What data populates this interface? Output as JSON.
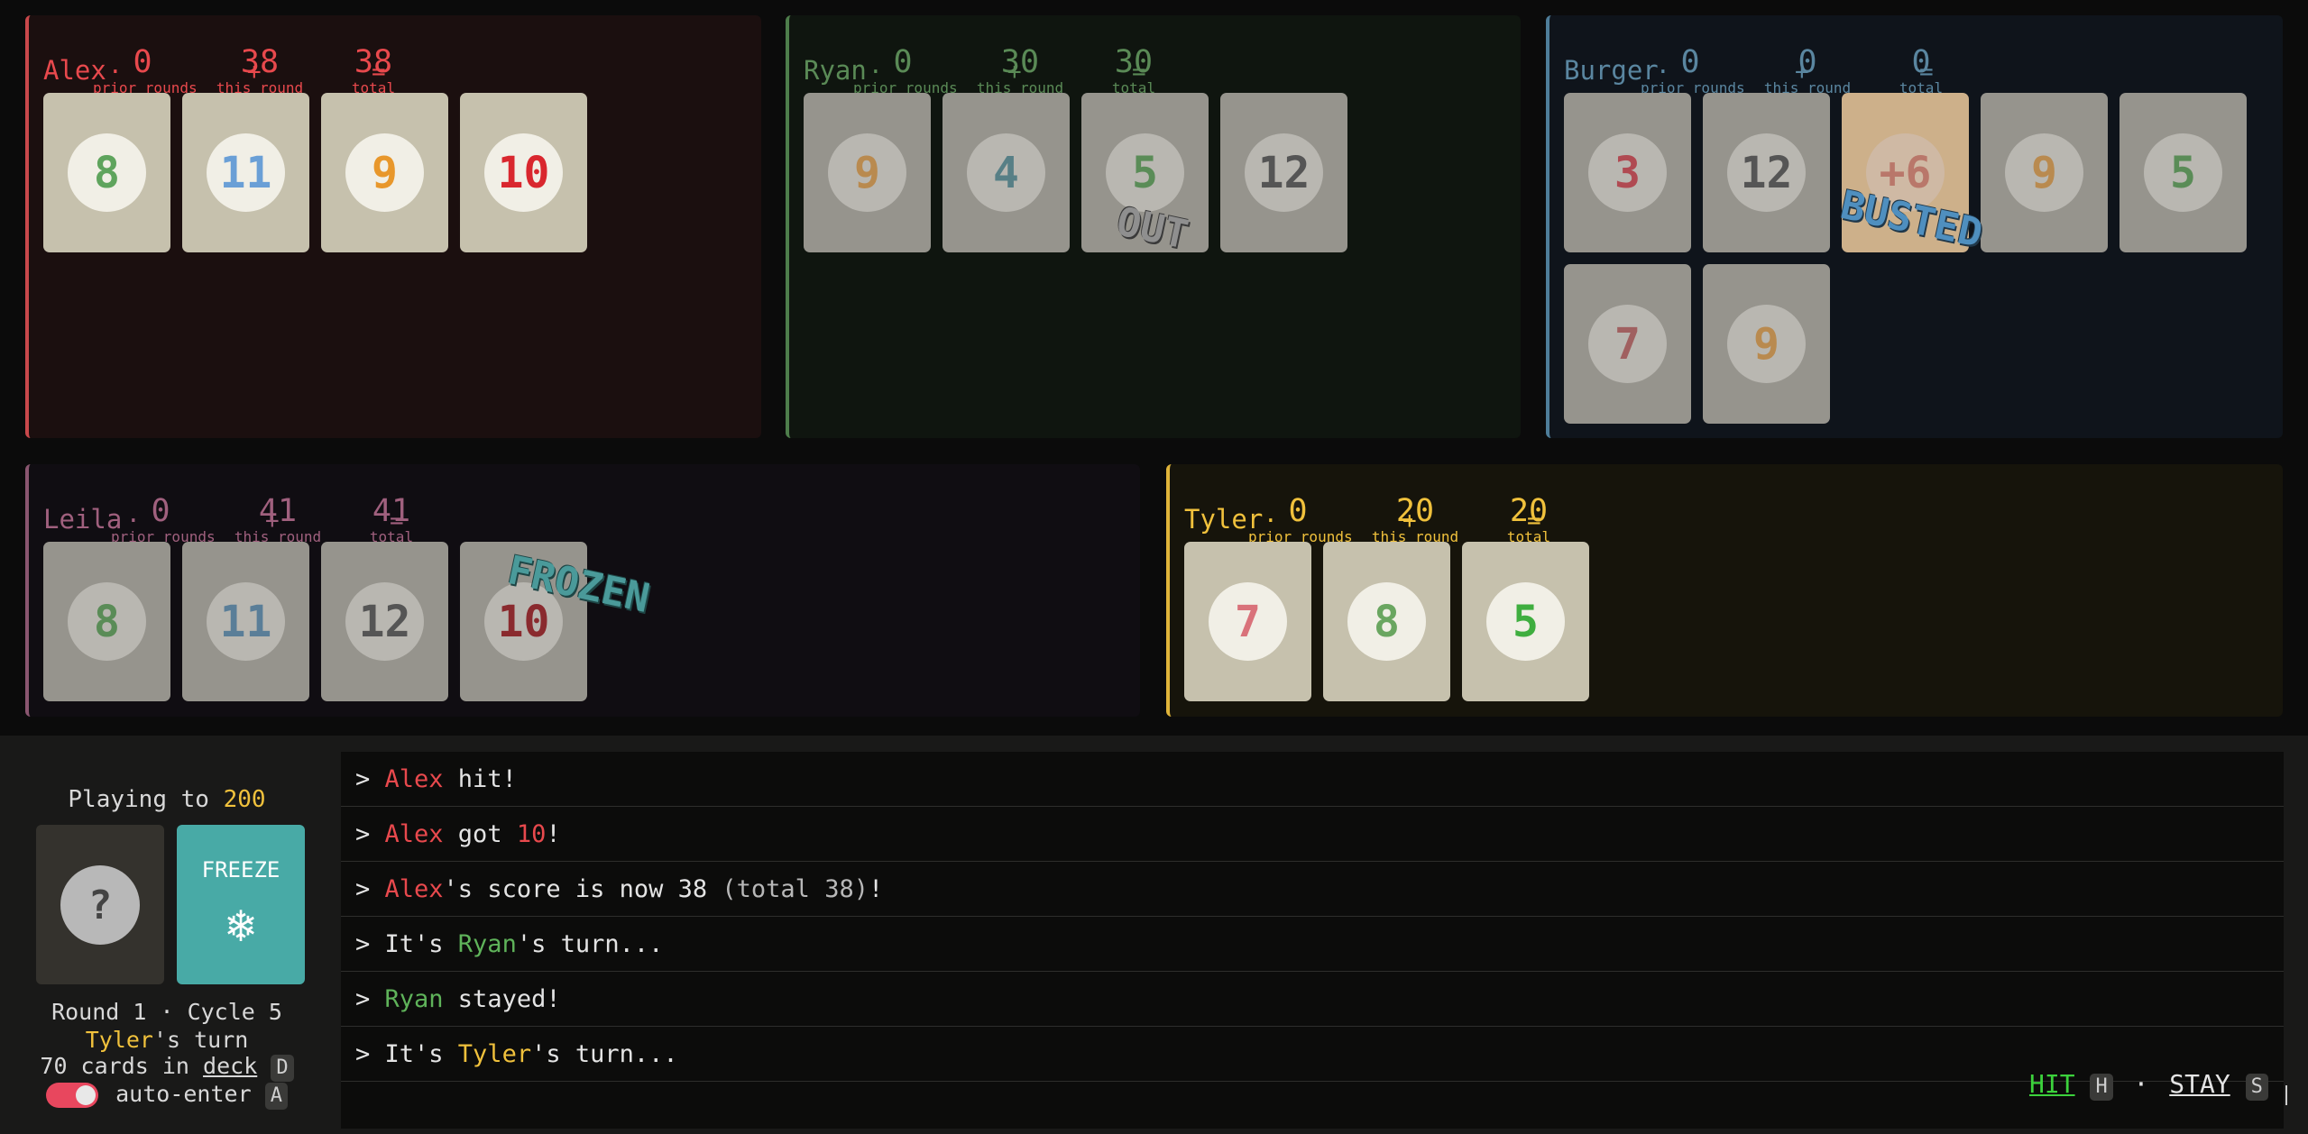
{
  "players": [
    {
      "id": "alex",
      "name": "Alex",
      "color": "#e8494d",
      "bg": "#1b0f0f",
      "border": "#c9484b",
      "prior": "0",
      "this_round": "38",
      "total": "38",
      "labels": {
        "prior": "prior rounds",
        "this": "this round",
        "total": "total"
      },
      "status": "",
      "cards": [
        {
          "value": "8",
          "color": "#5fa45d"
        },
        {
          "value": "11",
          "color": "#6a9fd6"
        },
        {
          "value": "9",
          "color": "#e8972b"
        },
        {
          "value": "10",
          "color": "#d9272e"
        }
      ]
    },
    {
      "id": "ryan",
      "name": "Ryan",
      "color": "#5a8a56",
      "bg": "#0f150f",
      "border": "#4e7d4b",
      "prior": "0",
      "this_round": "30",
      "total": "30",
      "labels": {
        "prior": "prior rounds",
        "this": "this round",
        "total": "total"
      },
      "status": "OUT",
      "cards": [
        {
          "value": "9",
          "color": "#b98a4f"
        },
        {
          "value": "4",
          "color": "#577f86"
        },
        {
          "value": "5",
          "color": "#5a8c57"
        },
        {
          "value": "12",
          "color": "#555555"
        }
      ]
    },
    {
      "id": "burger",
      "name": "Burger",
      "color": "#5a86a0",
      "bg": "#0f141b",
      "border": "#4e7d99",
      "prior": "0",
      "this_round": "0",
      "total": "0",
      "labels": {
        "prior": "prior rounds",
        "this": "this round",
        "total": "total"
      },
      "status": "BUSTED",
      "cards": [
        {
          "value": "3",
          "color": "#b04a52"
        },
        {
          "value": "12",
          "color": "#555555"
        },
        {
          "value": "+6",
          "color": "#b9776a",
          "special": true
        },
        {
          "value": "9",
          "color": "#b98a4f"
        },
        {
          "value": "5",
          "color": "#5a8c57"
        },
        {
          "value": "7",
          "color": "#a06060"
        },
        {
          "value": "9",
          "color": "#b98a4f"
        }
      ]
    },
    {
      "id": "leila",
      "name": "Leila",
      "color": "#a0607e",
      "bg": "#100d12",
      "border": "#8a5670",
      "prior": "0",
      "this_round": "41",
      "total": "41",
      "labels": {
        "prior": "prior rounds",
        "this": "this round",
        "total": "total"
      },
      "status": "FROZEN",
      "cards": [
        {
          "value": "8",
          "color": "#5a8c57"
        },
        {
          "value": "11",
          "color": "#5a7e98"
        },
        {
          "value": "12",
          "color": "#555555"
        },
        {
          "value": "10",
          "color": "#8a2a2e"
        }
      ]
    },
    {
      "id": "tyler",
      "name": "Tyler",
      "color": "#f0c13c",
      "bg": "#16140b",
      "border": "#e0b43a",
      "prior": "0",
      "this_round": "20",
      "total": "20",
      "labels": {
        "prior": "prior rounds",
        "this": "this round",
        "total": "total"
      },
      "status": "",
      "cards": [
        {
          "value": "7",
          "color": "#d9727a"
        },
        {
          "value": "8",
          "color": "#6aa660"
        },
        {
          "value": "5",
          "color": "#3fae3f"
        }
      ]
    }
  ],
  "status_panel": {
    "playing_to_label": "Playing to",
    "target": "200",
    "deck_card_glyph": "?",
    "freeze_card_label": "FREEZE",
    "freeze_icon": "❄",
    "round_line": "Round 1 · Cycle 5",
    "turn_player": "Tyler",
    "turn_suffix": "'s turn",
    "cards_count_text": "70 cards in",
    "deck_word": "deck",
    "deck_key": "D",
    "auto_enter_label": "auto-enter",
    "auto_enter_key": "A",
    "auto_enter_on": true
  },
  "log": [
    [
      {
        "t": "> "
      },
      {
        "t": "Alex",
        "c": "#e8494d"
      },
      {
        "t": " hit!"
      }
    ],
    [
      {
        "t": "> "
      },
      {
        "t": "Alex",
        "c": "#e8494d"
      },
      {
        "t": " got "
      },
      {
        "t": "10",
        "c": "#e8494d"
      },
      {
        "t": "!"
      }
    ],
    [
      {
        "t": "> "
      },
      {
        "t": "Alex",
        "c": "#e8494d"
      },
      {
        "t": "'s score is now 38 "
      },
      {
        "t": "(total 38)",
        "c": "#b8b8b8"
      },
      {
        "t": "!"
      }
    ],
    [
      {
        "t": "> It's "
      },
      {
        "t": "Ryan",
        "c": "#5fb35a"
      },
      {
        "t": "'s turn..."
      }
    ],
    [
      {
        "t": "> "
      },
      {
        "t": "Ryan",
        "c": "#5fb35a"
      },
      {
        "t": " stayed!"
      }
    ],
    [
      {
        "t": "> It's "
      },
      {
        "t": "Tyler",
        "c": "#f0c13c"
      },
      {
        "t": "'s turn..."
      }
    ]
  ],
  "actions": {
    "hit_label": "HIT",
    "hit_key": "H",
    "separator": "·",
    "stay_label": "STAY",
    "stay_key": "S"
  }
}
